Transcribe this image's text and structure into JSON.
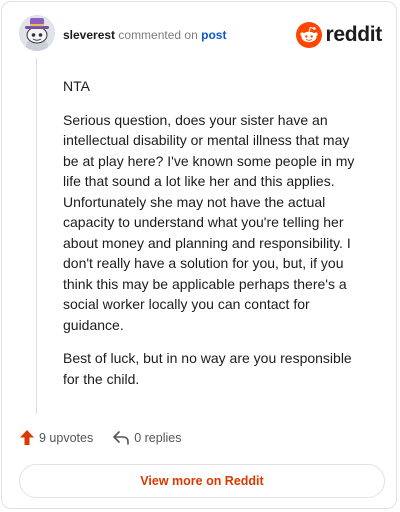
{
  "header": {
    "username": "sleverest",
    "commented_text": "commented on",
    "post_link": "post",
    "brand_name": "reddit"
  },
  "comment": {
    "paragraphs": [
      "NTA",
      "Serious question, does your sister have an intellectual disability or mental illness that may be at play here? I've known some people in my life that sound a lot like her and this applies. Unfortunately she may not have the actual capacity to understand what you're telling her about money and planning and responsibility. I don't really have a solution for you, but, if you think this may be applicable perhaps there's a social worker locally you can contact for guidance.",
      "Best of luck, but in no way are you responsible for the child."
    ]
  },
  "actions": {
    "upvotes": "9 upvotes",
    "replies": "0 replies"
  },
  "footer": {
    "view_more": "View more on Reddit"
  },
  "colors": {
    "brand": "#ff4500",
    "upvote": "#d93a00",
    "link": "#0b57c9"
  },
  "icons": {
    "avatar": "snoo-avatar-with-hat",
    "logo": "reddit-snoo-icon",
    "upvote": "upvote-arrow-icon",
    "reply": "reply-arrow-icon"
  }
}
